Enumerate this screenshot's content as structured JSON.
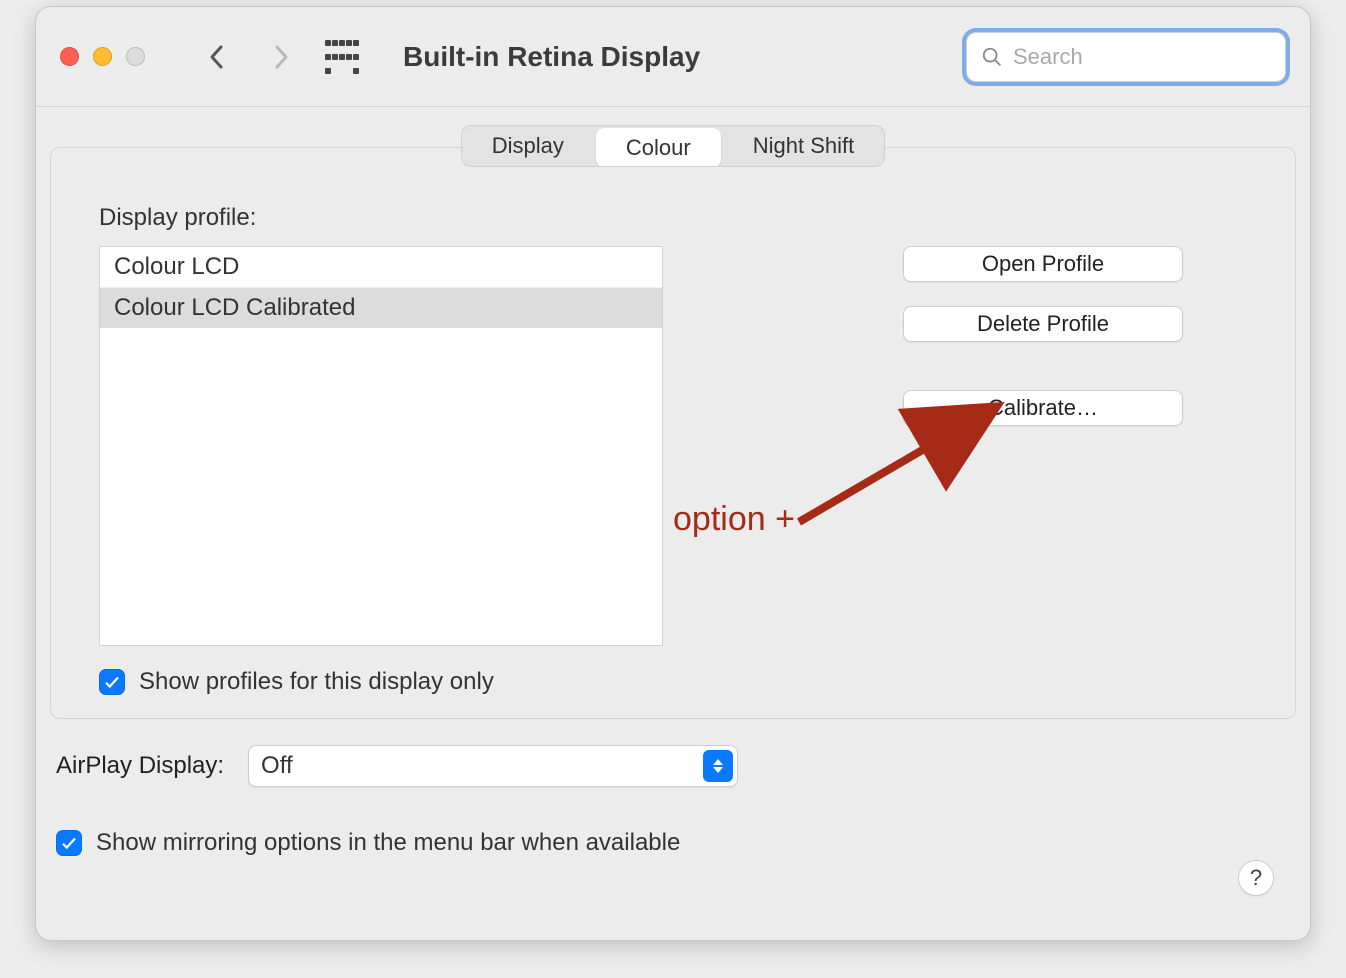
{
  "window": {
    "title": "Built-in Retina Display",
    "search_placeholder": "Search"
  },
  "tabs": {
    "display": "Display",
    "colour": "Colour",
    "nightshift": "Night Shift",
    "active": "colour"
  },
  "profile": {
    "heading": "Display profile:",
    "items": [
      "Colour LCD",
      "Colour LCD Calibrated"
    ],
    "selected_index": 1,
    "show_only_label": "Show profiles for this display only",
    "show_only_checked": true
  },
  "buttons": {
    "open_profile": "Open Profile",
    "delete_profile": "Delete Profile",
    "calibrate": "Calibrate…"
  },
  "airplay": {
    "label": "AirPlay Display:",
    "value": "Off"
  },
  "mirroring": {
    "label": "Show mirroring options in the menu bar when available",
    "checked": true
  },
  "help_label": "?",
  "annotation": {
    "text": "option +",
    "color": "#a62b17"
  }
}
